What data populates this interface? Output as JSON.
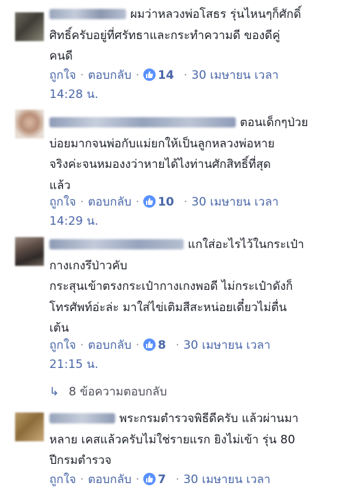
{
  "comments": [
    {
      "lines": [
        "ผมว่าหลวงพ่อโสธร รุ่นไหนๆก็ศักดิ์",
        "ศิทธิ์ครับอยู่ที่ศรัทธาและกระทำความดี ของดีคู่",
        "คนดี"
      ],
      "like_label": "ถูกใจ",
      "reply_label": "ตอบกลับ",
      "like_count": "14",
      "date": "30 เมษายน เวลา",
      "time": "14:28 น."
    },
    {
      "lines": [
        "ตอนเด็กๆป่วย",
        "บ่อยมากจนพ่อกับแม่ยกให้เป็นลูกหลวงพ่อหาย",
        "จริงค่ะจนหมองงว่าหายได้ไงท่านศักสิทธิ์ที่สุด",
        "แล้ว"
      ],
      "like_label": "ถูกใจ",
      "reply_label": "ตอบกลับ",
      "like_count": "10",
      "date": "30 เมษายน เวลา",
      "time": "14:29 น."
    },
    {
      "lines": [
        "แกใส่อะไรไว้ในกระเป๋า",
        "กางเกงรึป่าวคับ",
        "กระสุนเข้าตรงกระเป๋ากางเกงพอดี ไม่กระเป๋าดังก็",
        "โทรศัพท์อ่ะล่ะ มาใส่ไข่เติมสีสะหน่อยเดี๋ยวไม่ตื่น",
        "เต้น"
      ],
      "like_label": "ถูกใจ",
      "reply_label": "ตอบกลับ",
      "like_count": "8",
      "date": "30 เมษายน เวลา",
      "time": "21:15 น."
    },
    {
      "lines": [
        "พระกรมตำรวจพิธีดีครับ แล้วผ่านมา",
        "หลาย เคสแล้วครับไม่ใช่รายแรก ยิงไม่เข้า รุ่น 80",
        "ปีกรมตำรวจ"
      ],
      "like_label": "ถูกใจ",
      "reply_label": "ตอบกลับ",
      "like_count": "7",
      "date": "30 เมษายน เวลา",
      "time": ""
    }
  ],
  "replies_link": {
    "arrow": "↳",
    "label": "8 ข้อความตอบกลับ"
  },
  "colors": {
    "link": "#4a67a8",
    "like_badge": "#5890ff",
    "meta": "#7f7f7f"
  },
  "icons": {
    "like": "thumbs-up-icon"
  }
}
